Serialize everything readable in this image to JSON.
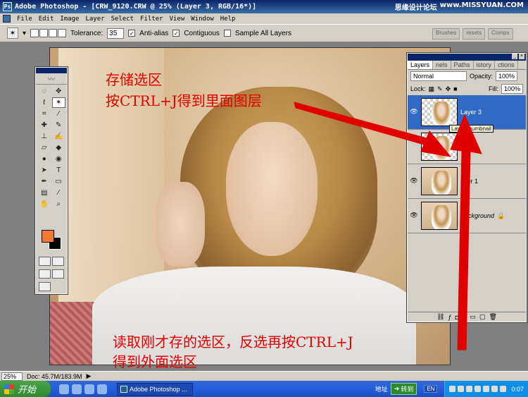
{
  "window": {
    "title": "Adobe Photoshop - [CRW_9120.CRW @ 25% (Layer 3, RGB/16*)]"
  },
  "watermark": {
    "text": "思缘设计论坛",
    "site": "www.MISSYUAN.COM"
  },
  "menu": {
    "items": [
      "File",
      "Edit",
      "Image",
      "Layer",
      "Select",
      "Filter",
      "View",
      "Window",
      "Help"
    ]
  },
  "options": {
    "tolerance_label": "Tolerance:",
    "tolerance_value": "35",
    "anti_alias": "Anti-alias",
    "contiguous": "Contiguous",
    "sample_all_layers": "Sample All Layers"
  },
  "palette_well": {
    "tabs": [
      "Brushes",
      "resets",
      "Comps"
    ]
  },
  "layers_panel": {
    "tabs": [
      "Layers",
      "nels",
      "Paths",
      "istory",
      "ctions"
    ],
    "blend_mode": "Normal",
    "opacity_label": "Opacity:",
    "opacity_value": "100%",
    "lock_label": "Lock:",
    "fill_label": "Fill:",
    "fill_value": "100%",
    "layers": [
      {
        "name": "Layer 3",
        "selected": true
      },
      {
        "name": "r 2",
        "selected": false
      },
      {
        "name": "ayer 1",
        "selected": false
      },
      {
        "name": "Background",
        "selected": false
      }
    ],
    "tooltip": "Layer thumbnail"
  },
  "annotations": {
    "top_line1": "存储选区",
    "top_line2": "按CTRL+J得到里面图层",
    "bottom_line1": "读取刚才存的选区，反选再按CTRL+J",
    "bottom_line2": "得到外面选区"
  },
  "status": {
    "zoom": "25%",
    "doc": "Doc: 45.7M/183.9M"
  },
  "taskbar": {
    "start": "开始",
    "task": "Adobe Photoshop ...",
    "address_label": "地址",
    "go": "转到",
    "lang": "EN",
    "clock": "0:07"
  },
  "colors": {
    "foreground": "#f47a30",
    "background": "#000000",
    "annotation": "#e00000"
  }
}
